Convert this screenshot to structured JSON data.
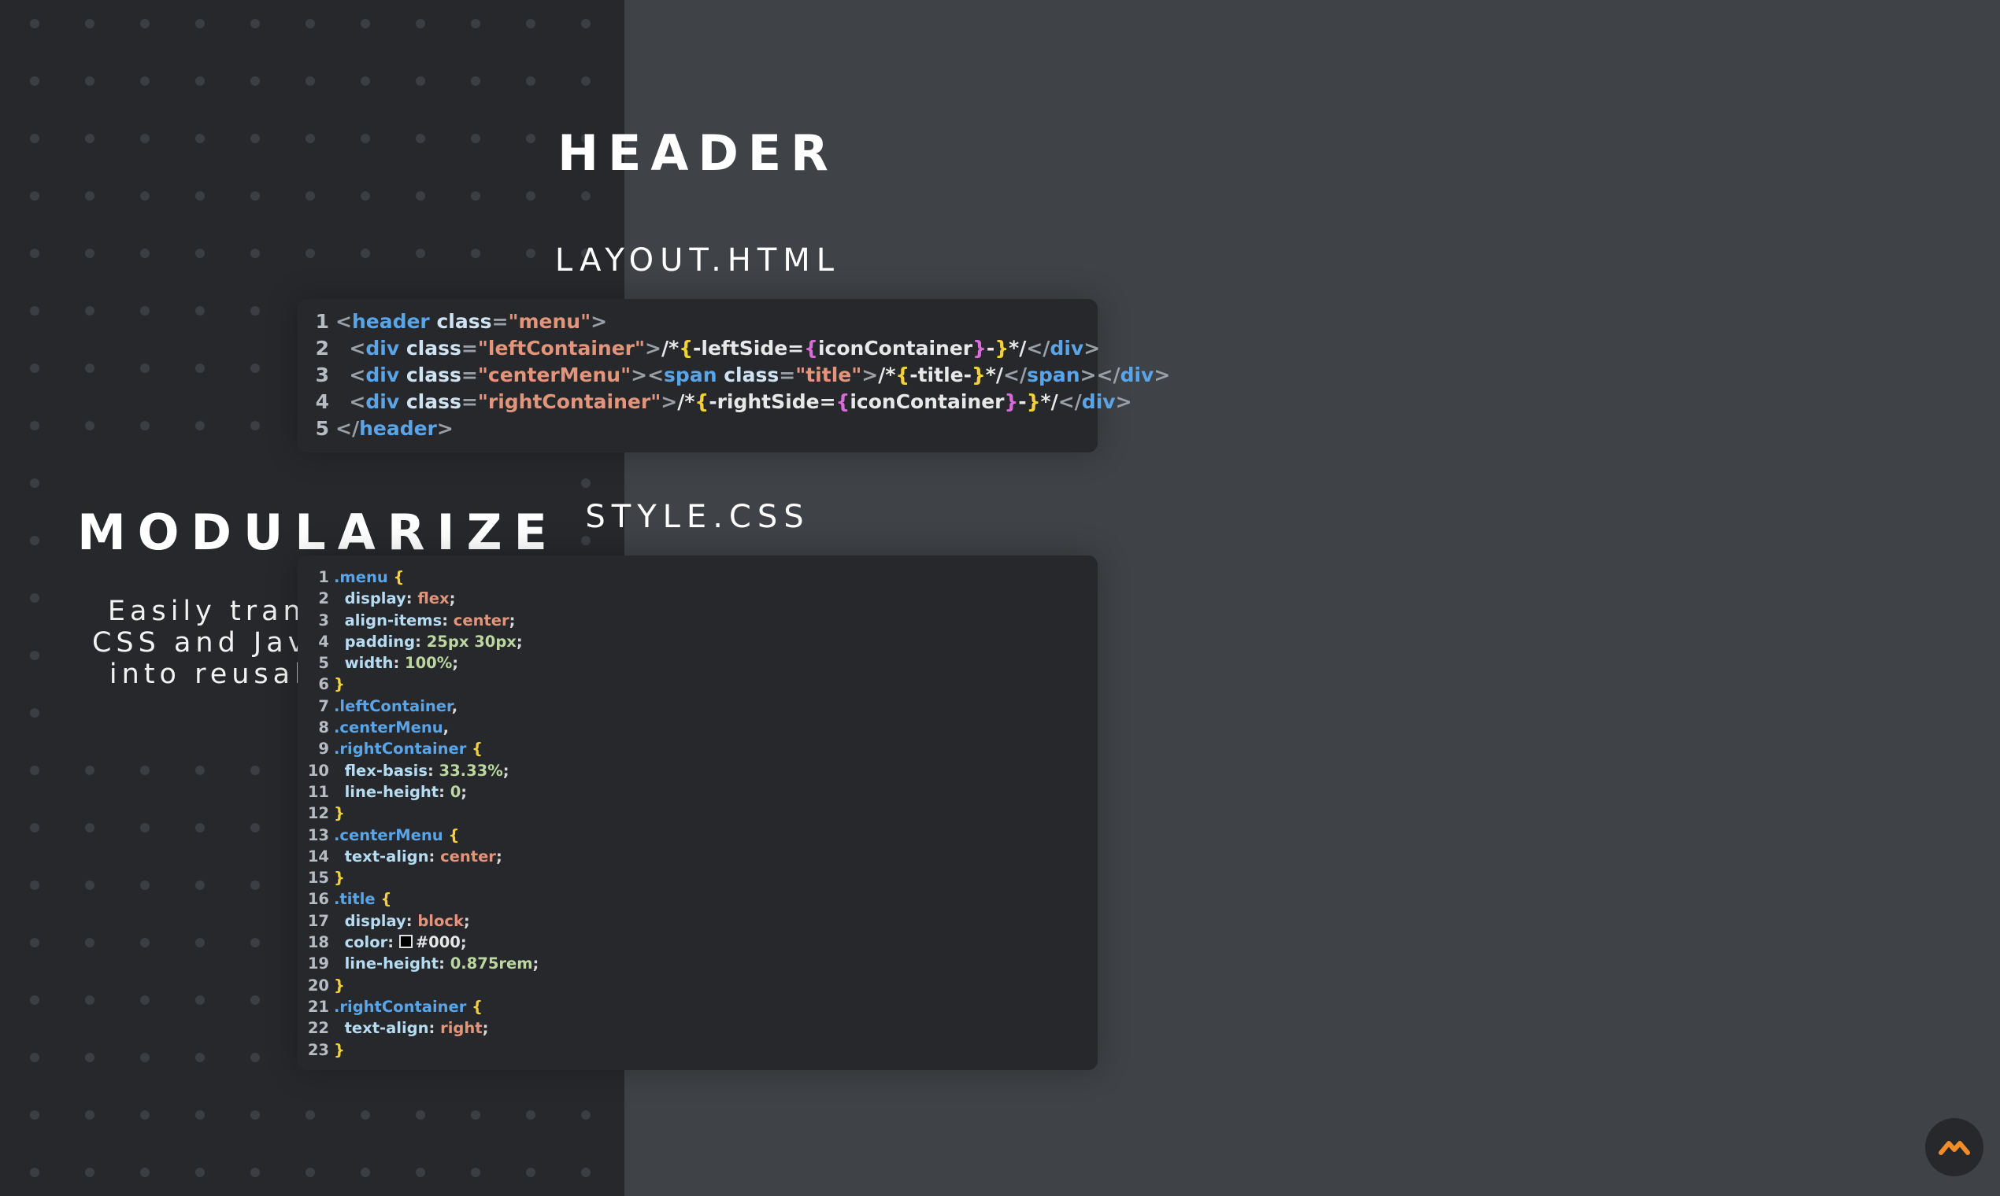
{
  "left": {
    "title": "MODULARIZE",
    "tagline": [
      "Easily transform HTML",
      "CSS and JavaScript files",
      "into reusable modules"
    ]
  },
  "main": {
    "title": "HEADER",
    "html_label": "LAYOUT.HTML",
    "css_label": "STYLE.CSS"
  },
  "html_code": [
    {
      "n": "1",
      "tokens": [
        [
          "p",
          "<"
        ],
        [
          "tag",
          "header"
        ],
        [
          "txt",
          " "
        ],
        [
          "attr",
          "class"
        ],
        [
          "p",
          "="
        ],
        [
          "str",
          "\"menu\""
        ],
        [
          "p",
          ">"
        ]
      ]
    },
    {
      "n": "2",
      "tokens": [
        [
          "txt",
          "  "
        ],
        [
          "p",
          "<"
        ],
        [
          "tag",
          "div"
        ],
        [
          "txt",
          " "
        ],
        [
          "attr",
          "class"
        ],
        [
          "p",
          "="
        ],
        [
          "str",
          "\"leftContainer\""
        ],
        [
          "p",
          ">"
        ],
        [
          "txt",
          "/*"
        ],
        [
          "b1",
          "{"
        ],
        [
          "txt",
          "-leftSide="
        ],
        [
          "b2",
          "{"
        ],
        [
          "txt",
          "iconContainer"
        ],
        [
          "b2",
          "}"
        ],
        [
          "txt",
          "-"
        ],
        [
          "b1",
          "}"
        ],
        [
          "txt",
          "*/"
        ],
        [
          "p",
          "</"
        ],
        [
          "tag",
          "div"
        ],
        [
          "p",
          ">"
        ]
      ]
    },
    {
      "n": "3",
      "tokens": [
        [
          "txt",
          "  "
        ],
        [
          "p",
          "<"
        ],
        [
          "tag",
          "div"
        ],
        [
          "txt",
          " "
        ],
        [
          "attr",
          "class"
        ],
        [
          "p",
          "="
        ],
        [
          "str",
          "\"centerMenu\""
        ],
        [
          "p",
          "><"
        ],
        [
          "tag",
          "span"
        ],
        [
          "txt",
          " "
        ],
        [
          "attr",
          "class"
        ],
        [
          "p",
          "="
        ],
        [
          "str",
          "\"title\""
        ],
        [
          "p",
          ">"
        ],
        [
          "txt",
          "/*"
        ],
        [
          "b1",
          "{"
        ],
        [
          "txt",
          "-title-"
        ],
        [
          "b1",
          "}"
        ],
        [
          "txt",
          "*/"
        ],
        [
          "p",
          "</"
        ],
        [
          "tag",
          "span"
        ],
        [
          "p",
          "></"
        ],
        [
          "tag",
          "div"
        ],
        [
          "p",
          ">"
        ]
      ]
    },
    {
      "n": "4",
      "tokens": [
        [
          "txt",
          "  "
        ],
        [
          "p",
          "<"
        ],
        [
          "tag",
          "div"
        ],
        [
          "txt",
          " "
        ],
        [
          "attr",
          "class"
        ],
        [
          "p",
          "="
        ],
        [
          "str",
          "\"rightContainer\""
        ],
        [
          "p",
          ">"
        ],
        [
          "txt",
          "/*"
        ],
        [
          "b1",
          "{"
        ],
        [
          "txt",
          "-rightSide="
        ],
        [
          "b2",
          "{"
        ],
        [
          "txt",
          "iconContainer"
        ],
        [
          "b2",
          "}"
        ],
        [
          "txt",
          "-"
        ],
        [
          "b1",
          "}"
        ],
        [
          "txt",
          "*/"
        ],
        [
          "p",
          "</"
        ],
        [
          "tag",
          "div"
        ],
        [
          "p",
          ">"
        ]
      ]
    },
    {
      "n": "5",
      "tokens": [
        [
          "p",
          "</"
        ],
        [
          "tag",
          "header"
        ],
        [
          "p",
          ">"
        ]
      ]
    }
  ],
  "css_code": [
    {
      "n": "1",
      "tokens": [
        [
          "sel",
          ".menu"
        ],
        [
          "txt",
          " "
        ],
        [
          "b1",
          "{"
        ]
      ]
    },
    {
      "n": "2",
      "tokens": [
        [
          "txt",
          "  "
        ],
        [
          "prop",
          "display"
        ],
        [
          "punc",
          ": "
        ],
        [
          "val",
          "flex"
        ],
        [
          "punc",
          ";"
        ]
      ]
    },
    {
      "n": "3",
      "tokens": [
        [
          "txt",
          "  "
        ],
        [
          "prop",
          "align-items"
        ],
        [
          "punc",
          ": "
        ],
        [
          "val",
          "center"
        ],
        [
          "punc",
          ";"
        ]
      ]
    },
    {
      "n": "4",
      "tokens": [
        [
          "txt",
          "  "
        ],
        [
          "prop",
          "padding"
        ],
        [
          "punc",
          ": "
        ],
        [
          "num",
          "25px 30px"
        ],
        [
          "punc",
          ";"
        ]
      ]
    },
    {
      "n": "5",
      "tokens": [
        [
          "txt",
          "  "
        ],
        [
          "prop",
          "width"
        ],
        [
          "punc",
          ": "
        ],
        [
          "num",
          "100%"
        ],
        [
          "punc",
          ";"
        ]
      ]
    },
    {
      "n": "6",
      "tokens": [
        [
          "b1",
          "}"
        ]
      ]
    },
    {
      "n": "7",
      "tokens": [
        [
          "sel",
          ".leftContainer"
        ],
        [
          "punc",
          ","
        ]
      ]
    },
    {
      "n": "8",
      "tokens": [
        [
          "sel",
          ".centerMenu"
        ],
        [
          "punc",
          ","
        ]
      ]
    },
    {
      "n": "9",
      "tokens": [
        [
          "sel",
          ".rightContainer"
        ],
        [
          "txt",
          " "
        ],
        [
          "b1",
          "{"
        ]
      ]
    },
    {
      "n": "10",
      "tokens": [
        [
          "txt",
          "  "
        ],
        [
          "prop",
          "flex-basis"
        ],
        [
          "punc",
          ": "
        ],
        [
          "num",
          "33.33%"
        ],
        [
          "punc",
          ";"
        ]
      ]
    },
    {
      "n": "11",
      "tokens": [
        [
          "txt",
          "  "
        ],
        [
          "prop",
          "line-height"
        ],
        [
          "punc",
          ": "
        ],
        [
          "num",
          "0"
        ],
        [
          "punc",
          ";"
        ]
      ]
    },
    {
      "n": "12",
      "tokens": [
        [
          "b1",
          "}"
        ]
      ]
    },
    {
      "n": "13",
      "tokens": [
        [
          "sel",
          ".centerMenu"
        ],
        [
          "txt",
          " "
        ],
        [
          "b1",
          "{"
        ]
      ]
    },
    {
      "n": "14",
      "tokens": [
        [
          "txt",
          "  "
        ],
        [
          "prop",
          "text-align"
        ],
        [
          "punc",
          ": "
        ],
        [
          "val",
          "center"
        ],
        [
          "punc",
          ";"
        ]
      ]
    },
    {
      "n": "15",
      "tokens": [
        [
          "b1",
          "}"
        ]
      ]
    },
    {
      "n": "16",
      "tokens": [
        [
          "sel",
          ".title"
        ],
        [
          "txt",
          " "
        ],
        [
          "b1",
          "{"
        ]
      ]
    },
    {
      "n": "17",
      "tokens": [
        [
          "txt",
          "  "
        ],
        [
          "prop",
          "display"
        ],
        [
          "punc",
          ": "
        ],
        [
          "val",
          "block"
        ],
        [
          "punc",
          ";"
        ]
      ]
    },
    {
      "n": "18",
      "tokens": [
        [
          "txt",
          "  "
        ],
        [
          "prop",
          "color"
        ],
        [
          "punc",
          ": "
        ],
        [
          "swatch",
          ""
        ],
        [
          "txt",
          "#000"
        ],
        [
          "punc",
          ";"
        ]
      ]
    },
    {
      "n": "19",
      "tokens": [
        [
          "txt",
          "  "
        ],
        [
          "prop",
          "line-height"
        ],
        [
          "punc",
          ": "
        ],
        [
          "num",
          "0.875rem"
        ],
        [
          "punc",
          ";"
        ]
      ]
    },
    {
      "n": "20",
      "tokens": [
        [
          "b1",
          "}"
        ]
      ]
    },
    {
      "n": "21",
      "tokens": [
        [
          "sel",
          ".rightContainer"
        ],
        [
          "txt",
          " "
        ],
        [
          "b1",
          "{"
        ]
      ]
    },
    {
      "n": "22",
      "tokens": [
        [
          "txt",
          "  "
        ],
        [
          "prop",
          "text-align"
        ],
        [
          "punc",
          ": "
        ],
        [
          "val",
          "right"
        ],
        [
          "punc",
          ";"
        ]
      ]
    },
    {
      "n": "23",
      "tokens": [
        [
          "b1",
          "}"
        ]
      ]
    }
  ],
  "badge": {
    "icon": "logo-icon",
    "color": "#f28c28"
  }
}
